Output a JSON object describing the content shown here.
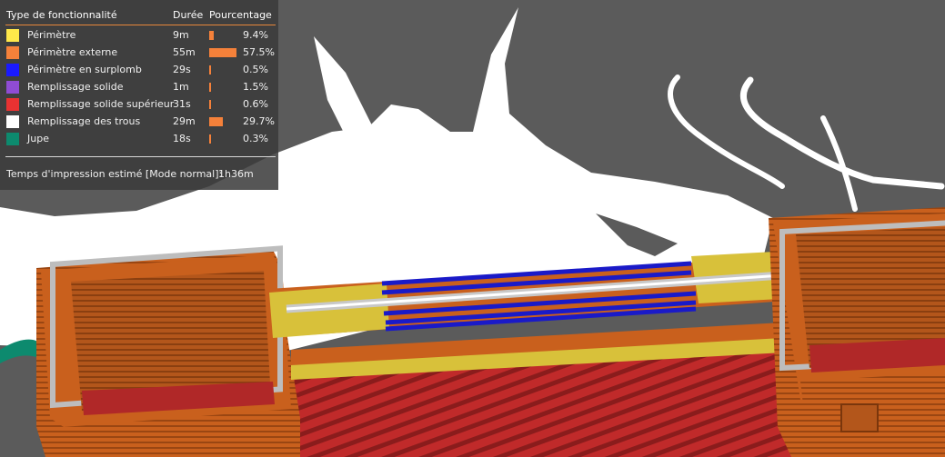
{
  "legend": {
    "headers": {
      "type": "Type de fonctionnalité",
      "duration": "Durée",
      "percentage": "Pourcentage"
    },
    "rows": [
      {
        "label": "Périmètre",
        "duration": "9m",
        "percent": "9.4%",
        "value": 9.4,
        "color": "#ffe84a"
      },
      {
        "label": "Périmètre externe",
        "duration": "55m",
        "percent": "57.5%",
        "value": 57.5,
        "color": "#f5813a"
      },
      {
        "label": "Périmètre en surplomb",
        "duration": "29s",
        "percent": "0.5%",
        "value": 0.5,
        "color": "#1a1aff"
      },
      {
        "label": "Remplissage solide",
        "duration": "1m",
        "percent": "1.5%",
        "value": 1.5,
        "color": "#8f4cd4"
      },
      {
        "label": "Remplissage solide supérieur",
        "duration": "31s",
        "percent": "0.6%",
        "value": 0.6,
        "color": "#e83232"
      },
      {
        "label": "Remplissage des trous",
        "duration": "29m",
        "percent": "29.7%",
        "value": 29.7,
        "color": "#ffffff"
      },
      {
        "label": "Jupe",
        "duration": "18s",
        "percent": "0.3%",
        "value": 0.3,
        "color": "#0d8a6e"
      }
    ],
    "estimate_label": "Temps d'impression estimé [Mode normal]:",
    "estimate_value": "1h36m"
  }
}
